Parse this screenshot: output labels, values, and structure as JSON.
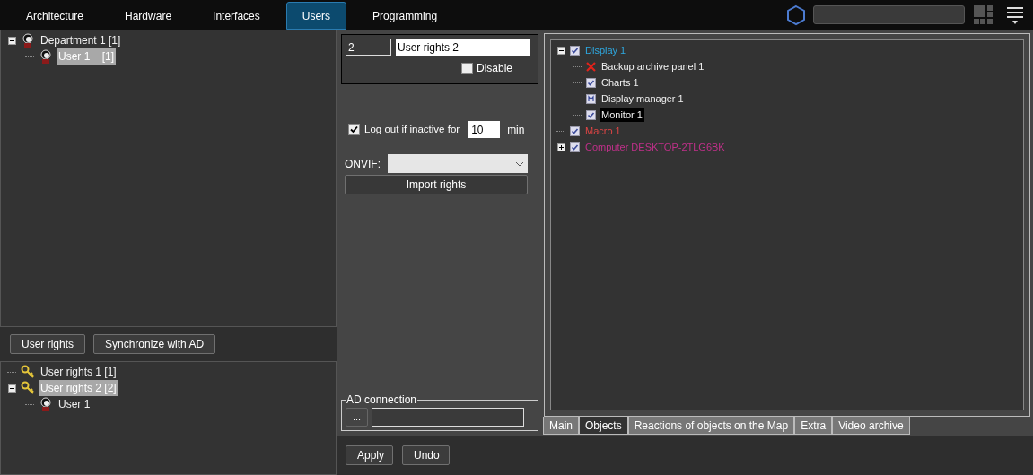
{
  "top_tabs": [
    {
      "label": "Architecture",
      "selected": false
    },
    {
      "label": "Hardware",
      "selected": false
    },
    {
      "label": "Interfaces",
      "selected": false
    },
    {
      "label": "Users",
      "selected": true
    },
    {
      "label": "Programming",
      "selected": false
    }
  ],
  "user_tree": [
    {
      "label": "Department 1 [1]",
      "kind": "person",
      "selected": false,
      "expanded": true,
      "children": [
        {
          "label": "User 1    [1]",
          "kind": "person",
          "selected": true
        }
      ]
    }
  ],
  "left_buttons": [
    "User rights",
    "Synchronize with AD"
  ],
  "rights_tree": [
    {
      "label": "User rights 1 [1]",
      "kind": "key",
      "selected": false
    },
    {
      "label": "User rights 2 [2]",
      "kind": "key",
      "selected": true,
      "expanded": true,
      "children": [
        {
          "label": "User 1",
          "kind": "person",
          "selected": false
        }
      ]
    }
  ],
  "rights_form": {
    "id": "2",
    "name": "User rights 2",
    "disable": {
      "label": "Disable",
      "checked": false
    }
  },
  "logout": {
    "label": "Log out if inactive for",
    "checked": true,
    "value": "10",
    "unit": "min"
  },
  "onvif": {
    "label": "ONVIF:"
  },
  "import_button": "Import rights",
  "ad_connection": {
    "legend": "AD connection",
    "button": "..."
  },
  "objects_tree": [
    {
      "label": "Display 1",
      "kind": "check",
      "color": "#2ea8e0",
      "selected": false,
      "expanded": true,
      "children": [
        {
          "label": "Backup archive panel 1",
          "kind": "denied",
          "selected": false
        },
        {
          "label": "Charts 1",
          "kind": "check",
          "selected": false
        },
        {
          "label": "Display manager 1",
          "kind": "manager",
          "selected": false
        },
        {
          "label": "Monitor 1",
          "kind": "check",
          "selected": true
        }
      ]
    },
    {
      "label": "Macro 1",
      "kind": "check",
      "color": "#e04545",
      "selected": false
    },
    {
      "label": "Computer DESKTOP-2TLG6BK",
      "kind": "check",
      "color": "#c0308a",
      "selected": false,
      "expanded": false
    }
  ],
  "object_tabs": [
    {
      "label": "Main",
      "selected": false
    },
    {
      "label": "Objects",
      "selected": true
    },
    {
      "label": "Reactions of objects on the Map",
      "selected": false
    },
    {
      "label": "Extra",
      "selected": false
    },
    {
      "label": "Video archive",
      "selected": false
    }
  ],
  "actions": [
    "Apply",
    "Undo"
  ]
}
